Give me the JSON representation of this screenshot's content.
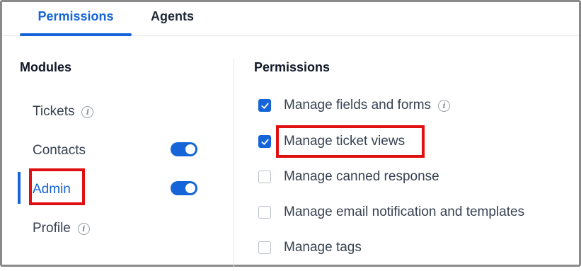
{
  "tabs": [
    {
      "label": "Permissions",
      "active": true
    },
    {
      "label": "Agents",
      "active": false
    }
  ],
  "modules": {
    "heading": "Modules",
    "items": [
      {
        "label": "Tickets",
        "info": true
      },
      {
        "label": "Contacts",
        "toggle": true
      },
      {
        "label": "Admin",
        "toggle": true,
        "active": true
      },
      {
        "label": "Profile",
        "info": true
      }
    ]
  },
  "permissions": {
    "heading": "Permissions",
    "items": [
      {
        "label": "Manage fields and forms",
        "checked": true,
        "info": true
      },
      {
        "label": "Manage ticket views",
        "checked": true
      },
      {
        "label": "Manage canned response",
        "checked": false
      },
      {
        "label": "Manage email notification and templates",
        "checked": false
      },
      {
        "label": "Manage tags",
        "checked": false
      }
    ]
  },
  "info_glyph": "i",
  "colors": {
    "accent": "#1565d8",
    "highlight": "#e01010"
  }
}
